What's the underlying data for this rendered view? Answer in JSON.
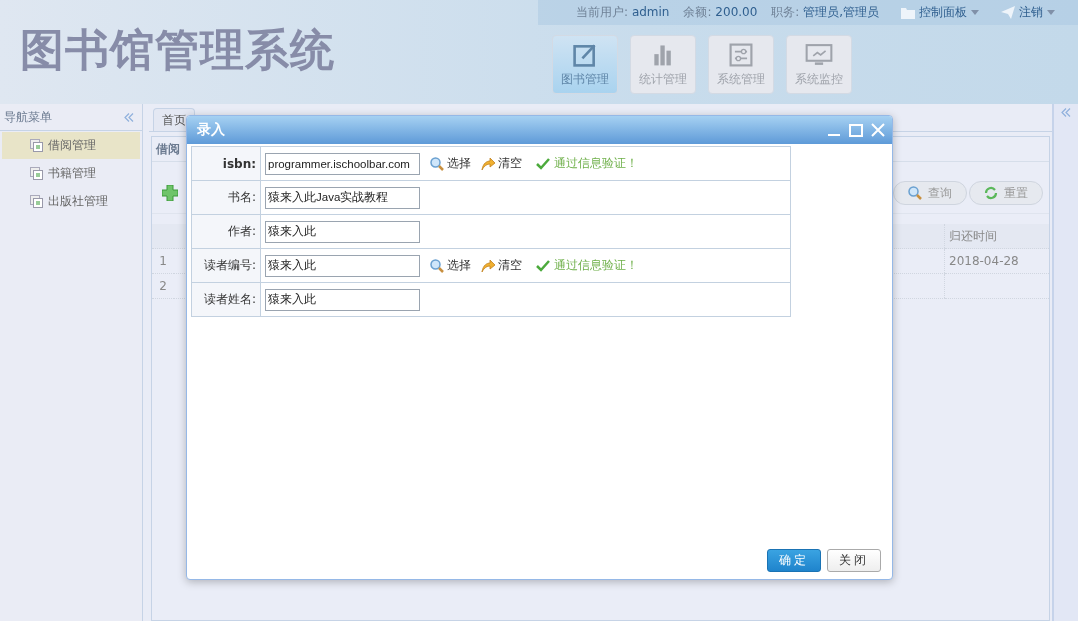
{
  "header": {
    "logo": "图书馆管理系统",
    "user_info": [
      {
        "label": "当前用户:",
        "value": "admin"
      },
      {
        "label": "余额:",
        "value": "200.00"
      },
      {
        "label": "职务:",
        "value": "管理员,管理员"
      }
    ],
    "menus": [
      {
        "kind": "panel",
        "label": "控制面板"
      },
      {
        "kind": "logout",
        "label": "注销"
      }
    ],
    "modules": [
      {
        "kind": "edit",
        "label": "图书管理",
        "selected": true
      },
      {
        "kind": "chart",
        "label": "统计管理",
        "selected": false
      },
      {
        "kind": "settings",
        "label": "系统管理",
        "selected": false
      },
      {
        "kind": "monitor",
        "label": "系统监控",
        "selected": false
      }
    ]
  },
  "sidebar": {
    "title": "导航菜单",
    "items": [
      {
        "label": "借阅管理",
        "selected": true
      },
      {
        "label": "书籍管理",
        "selected": false
      },
      {
        "label": "出版社管理",
        "selected": false
      }
    ]
  },
  "tabs": [
    {
      "label": "首页",
      "selected": false
    }
  ],
  "panel": {
    "title": "借阅",
    "buttons": [
      {
        "kind": "search",
        "label": "查询"
      },
      {
        "kind": "reset",
        "label": "重置"
      }
    ],
    "table": {
      "columns": [
        "归还时间"
      ],
      "rows": [
        {
          "number": "1",
          "cells": [
            "2018-04-28"
          ]
        },
        {
          "number": "2",
          "cells": [
            ""
          ]
        }
      ]
    }
  },
  "dialog": {
    "title": "录入",
    "fields": [
      {
        "label": "isbn:",
        "value": "programmer.ischoolbar.com",
        "bold": true,
        "actions": [
          "选择",
          "清空"
        ],
        "message": "通过信息验证！"
      },
      {
        "label": "书名:",
        "value": "猿来入此Java实战教程",
        "bold": false
      },
      {
        "label": "作者:",
        "value": "猿来入此",
        "bold": false
      },
      {
        "label": "读者编号:",
        "value": "猿来入此",
        "bold": false,
        "actions": [
          "选择",
          "清空"
        ],
        "message": "通过信息验证！"
      },
      {
        "label": "读者姓名:",
        "value": "猿来入此",
        "bold": false
      }
    ],
    "buttons": [
      {
        "kind": "primary",
        "label": "确定"
      },
      {
        "kind": "default",
        "label": "关闭"
      }
    ]
  }
}
